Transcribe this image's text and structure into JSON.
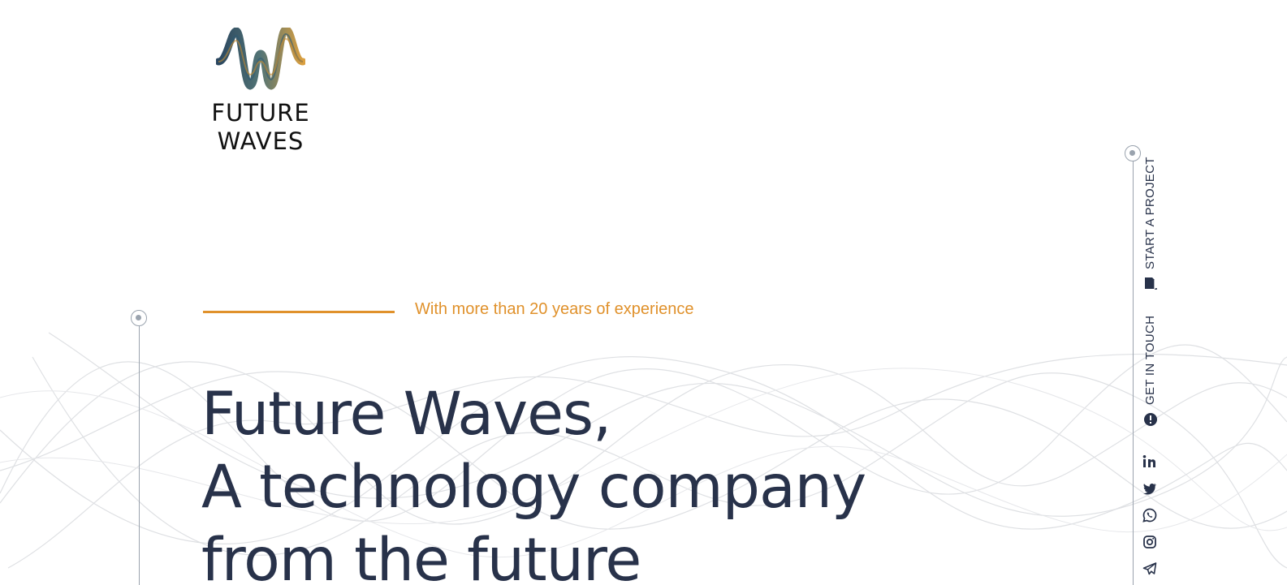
{
  "brand": {
    "line1": "FUTURE",
    "line2": "WAVES",
    "colors": {
      "navy": "#28324a",
      "gold": "#e0912b",
      "teal": "#2f5a73"
    }
  },
  "hero": {
    "tagline": "With more than 20 years of experience",
    "title_lines": [
      "Future Waves,",
      "A technology company",
      "from the future"
    ]
  },
  "side_nav": {
    "start_project": {
      "label": "START A PROJECT",
      "icon": "book-icon"
    },
    "get_in_touch": {
      "label": "GET IN TOUCH",
      "icon": "chat-bubble-icon"
    },
    "socials": [
      {
        "name": "linkedin",
        "icon": "linkedin-icon"
      },
      {
        "name": "twitter",
        "icon": "twitter-icon"
      },
      {
        "name": "whatsapp",
        "icon": "whatsapp-icon"
      },
      {
        "name": "instagram",
        "icon": "instagram-icon"
      },
      {
        "name": "telegram",
        "icon": "telegram-icon"
      }
    ]
  }
}
